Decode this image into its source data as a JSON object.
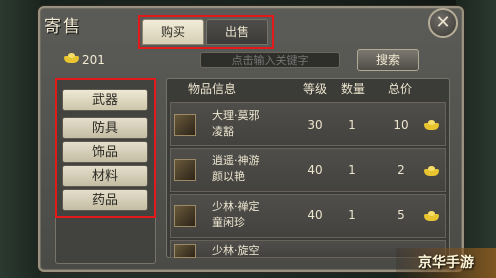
{
  "window": {
    "title": "寄售",
    "close_label": "✕"
  },
  "tabs": [
    {
      "label": "购买",
      "active": true
    },
    {
      "label": "出售",
      "active": false
    }
  ],
  "currency": {
    "icon": "gold-ingot-icon",
    "amount": "201"
  },
  "search": {
    "placeholder": "点击输入关键字",
    "button_label": "搜索"
  },
  "categories": [
    {
      "label": "武器",
      "active": true
    },
    {
      "label": "防具",
      "active": false
    },
    {
      "label": "饰品",
      "active": false
    },
    {
      "label": "材料",
      "active": false
    },
    {
      "label": "药品",
      "active": false
    }
  ],
  "table": {
    "headers": [
      "物品信息",
      "等级",
      "数量",
      "总价"
    ],
    "rows": [
      {
        "name_line1": "大理·莫邪",
        "name_line2": "凌豁",
        "level": "30",
        "qty": "1",
        "price": "10"
      },
      {
        "name_line1": "逍遥·神游",
        "name_line2": "颜以艳",
        "level": "40",
        "qty": "1",
        "price": "2"
      },
      {
        "name_line1": "少林·禅定",
        "name_line2": "童闲珍",
        "level": "40",
        "qty": "1",
        "price": "5"
      },
      {
        "name_line1": "少林·旋空",
        "name_line2": "",
        "level": "",
        "qty": "",
        "price": ""
      }
    ]
  },
  "watermark": "京华手游",
  "colors": {
    "highlight_border": "#e21a1a",
    "gold": "#e8c430",
    "panel": "#4a4a46"
  }
}
